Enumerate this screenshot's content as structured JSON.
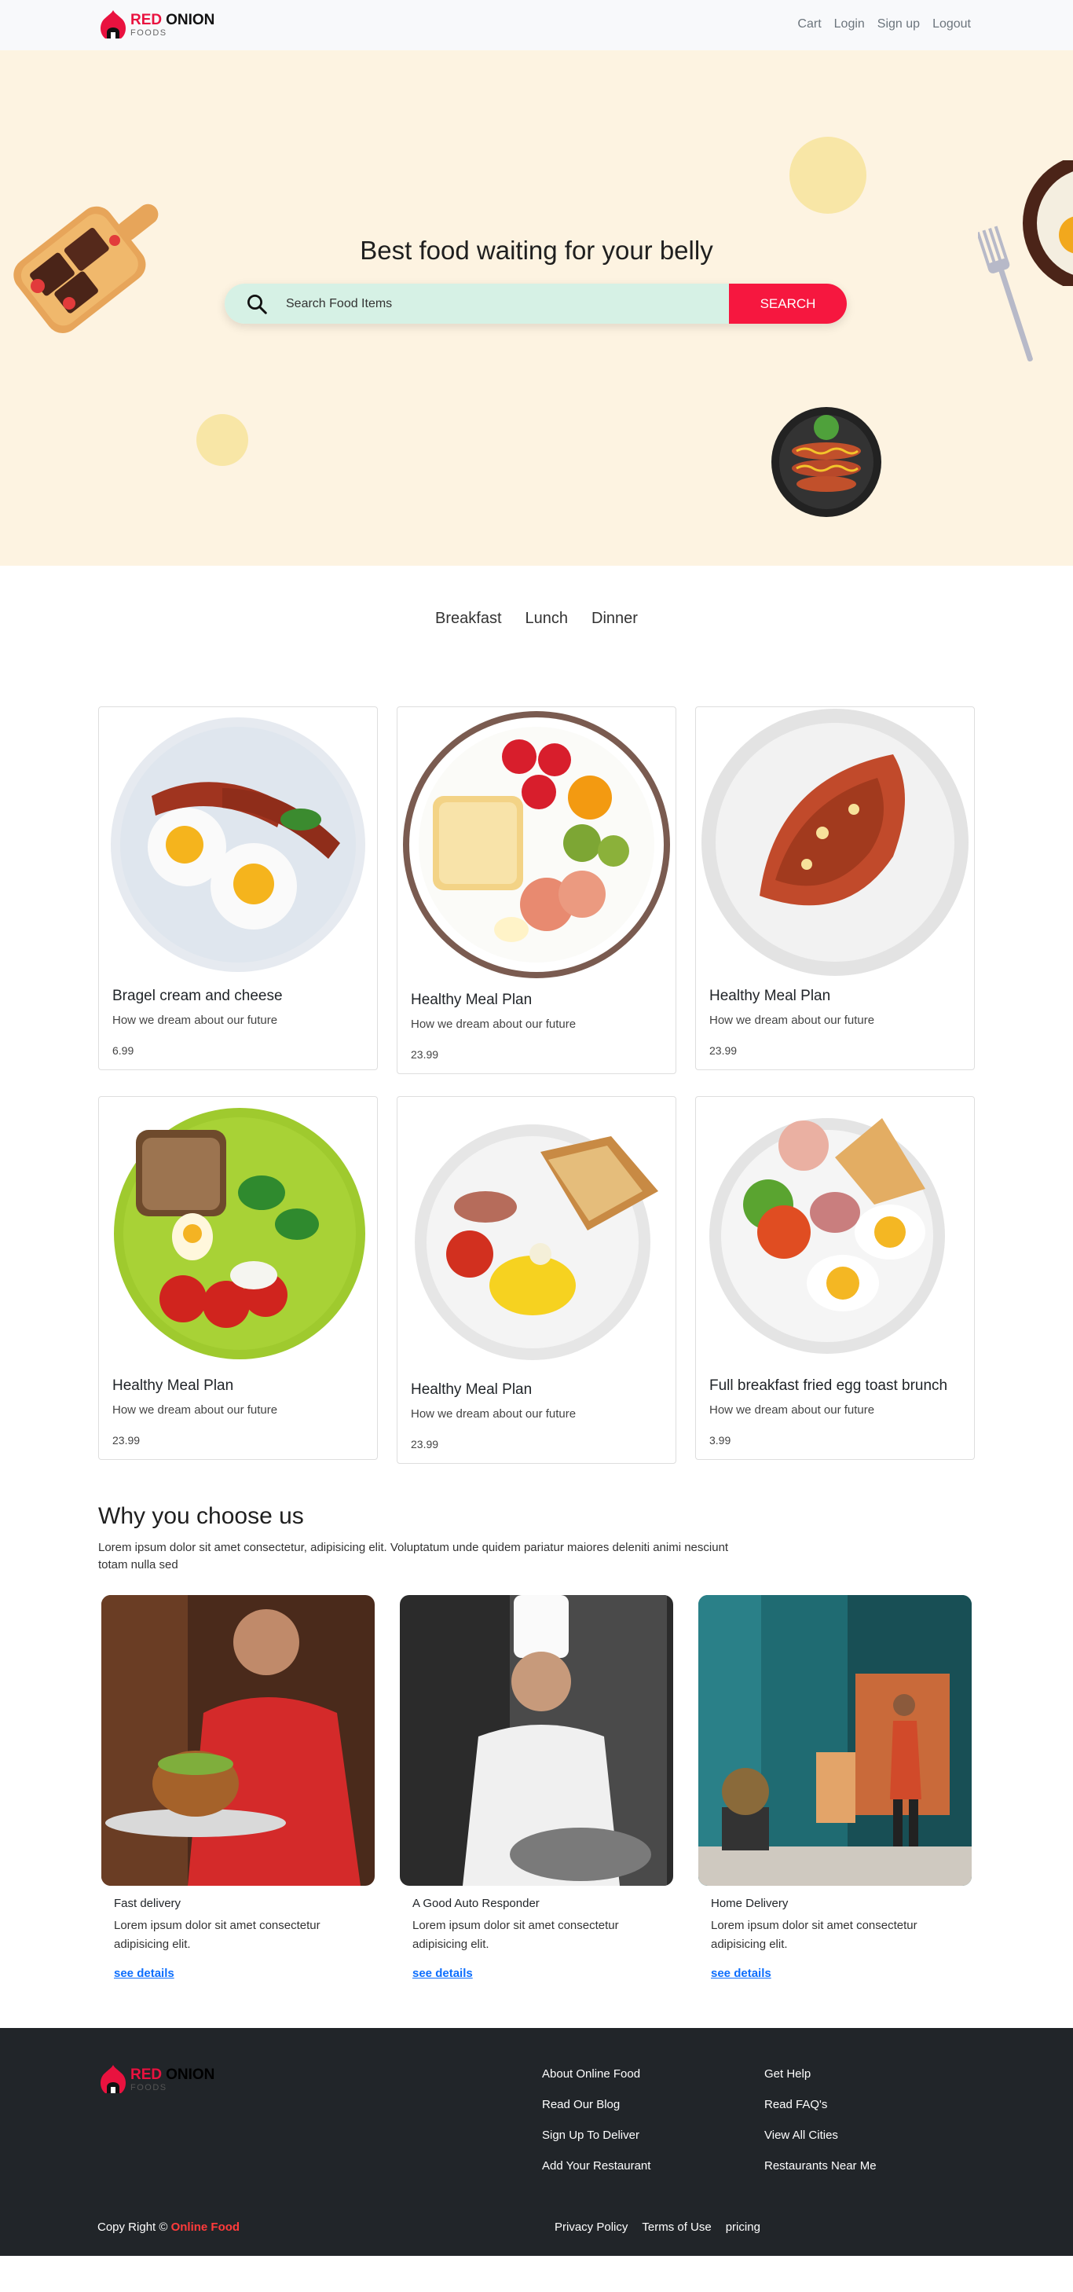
{
  "brand": {
    "name_red": "RED",
    "name_dark": "ONION",
    "tagline": "FOODS",
    "accent_color": "#e9123f"
  },
  "nav": {
    "links": [
      "Cart",
      "Login",
      "Sign up",
      "Logout"
    ]
  },
  "hero": {
    "title": "Best food waiting for your belly",
    "search_placeholder": "Search Food Items",
    "search_button": "SEARCH",
    "background_color": "#fdf3e1"
  },
  "tabs": [
    "Breakfast",
    "Lunch",
    "Dinner"
  ],
  "foods": [
    {
      "title": "Bragel cream and cheese",
      "description": "How we dream about our future",
      "price": "6.99"
    },
    {
      "title": "Healthy Meal Plan",
      "description": "How we dream about our future",
      "price": "23.99"
    },
    {
      "title": "Healthy Meal Plan",
      "description": "How we dream about our future",
      "price": "23.99"
    },
    {
      "title": "Healthy Meal Plan",
      "description": "How we dream about our future",
      "price": "23.99"
    },
    {
      "title": "Healthy Meal Plan",
      "description": "How we dream about our future",
      "price": "23.99"
    },
    {
      "title": "Full breakfast fried egg toast brunch",
      "description": "How we dream about our future",
      "price": "3.99"
    }
  ],
  "why": {
    "title": "Why you choose us",
    "text": "Lorem ipsum dolor sit amet consectetur, adipisicing elit. Voluptatum unde quidem pariatur maiores deleniti animi nesciunt totam nulla sed",
    "cards": [
      {
        "title": "Fast delivery",
        "text": "Lorem ipsum dolor sit amet consectetur adipisicing elit.",
        "link": "see details"
      },
      {
        "title": "A Good Auto Responder",
        "text": "Lorem ipsum dolor sit amet consectetur adipisicing elit.",
        "link": "see details"
      },
      {
        "title": "Home Delivery",
        "text": "Lorem ipsum dolor sit amet consectetur adipisicing elit.",
        "link": "see details"
      }
    ]
  },
  "footer": {
    "col1": [
      "About Online Food",
      "Read Our Blog",
      "Sign Up To Deliver",
      "Add Your Restaurant"
    ],
    "col2": [
      "Get Help",
      "Read FAQ's",
      "View All Cities",
      "Restaurants Near Me"
    ],
    "copyright_prefix": "Copy Right ©",
    "copyright_brand": "Online Food",
    "bottom_links": [
      "Privacy Policy",
      "Terms of Use",
      "pricing"
    ],
    "background_color": "#212529"
  }
}
